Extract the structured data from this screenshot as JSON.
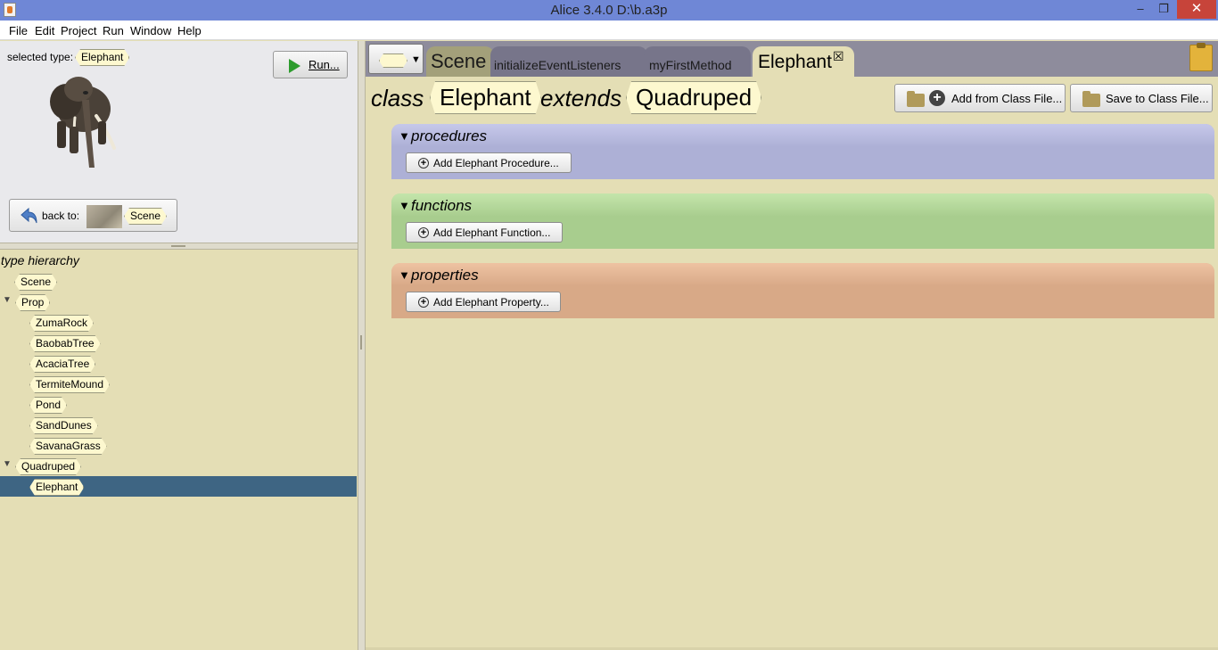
{
  "window": {
    "title": "Alice 3.4.0 D:\\b.a3p",
    "min_symbol": "–",
    "max_symbol": "❐",
    "close_symbol": "✕"
  },
  "menu": [
    "File",
    "Edit",
    "Project",
    "Run",
    "Window",
    "Help"
  ],
  "left": {
    "selected_type_label": "selected type:",
    "selected_type": "Elephant",
    "run_label": "Run...",
    "back_label": "back to:",
    "back_target": "Scene",
    "tree_title": "type hierarchy",
    "tree": {
      "scene": "Scene",
      "prop": "Prop",
      "prop_children": [
        "ZumaRock",
        "BaobabTree",
        "AcaciaTree",
        "TermiteMound",
        "Pond",
        "SandDunes",
        "SavanaGrass"
      ],
      "quadruped": "Quadruped",
      "quadruped_children": [
        "Elephant"
      ]
    },
    "expand_symbol": "▼"
  },
  "tabs": {
    "dropdown_caret": "▼",
    "items": [
      "Scene",
      "initializeEventListeners",
      "myFirstMethod",
      "Elephant"
    ],
    "close_symbol": "☒"
  },
  "class_header": {
    "class_kw": "class",
    "class_name": "Elephant",
    "extends_kw": "extends",
    "super_name": "Quadruped",
    "add_from_file": "Add from Class File...",
    "save_to_file": "Save to Class File..."
  },
  "sections": {
    "collapse_symbol": "▼",
    "add_symbol": "+",
    "procedures": {
      "name": "procedures",
      "add": "Add Elephant Procedure..."
    },
    "functions": {
      "name": "functions",
      "add": "Add Elephant Function..."
    },
    "properties": {
      "name": "properties",
      "add": "Add Elephant Property..."
    }
  },
  "colors": {
    "titlebar": "#6f87d6",
    "selection": "#3e6583",
    "procedures": "#adb0d6",
    "functions": "#a8cd8e",
    "properties": "#d8a987",
    "editor_bg": "#e4deb5"
  }
}
